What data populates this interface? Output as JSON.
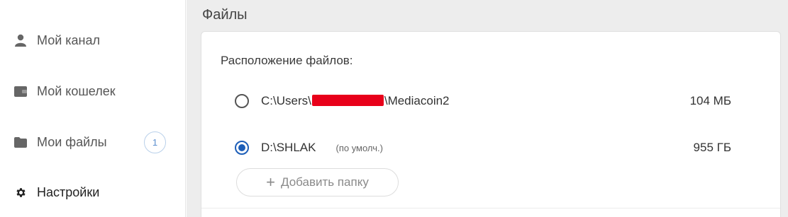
{
  "sidebar": {
    "items": [
      {
        "label": "Мой канал",
        "icon": "user-icon"
      },
      {
        "label": "Мой кошелек",
        "icon": "wallet-icon"
      },
      {
        "label": "Мои файлы",
        "icon": "folder-icon",
        "badge": "1"
      },
      {
        "label": "Настройки",
        "icon": "gear-icon",
        "active": true
      }
    ]
  },
  "main": {
    "section_title": "Файлы",
    "locations_label": "Расположение файлов:",
    "locations": [
      {
        "path_prefix": "C:\\Users\\",
        "path_suffix": "\\Mediacoin2",
        "size": "104 МБ",
        "selected": false
      },
      {
        "path": "D:\\SHLAK",
        "default_tag": "(по умолч.)",
        "size": "955 ГБ",
        "selected": true
      }
    ],
    "add_folder_label": "Добавить папку"
  },
  "colors": {
    "accent": "#1d5eb8",
    "redaction": "#e8001a",
    "main_bg": "#ededed",
    "badge": "#5b8fcf"
  }
}
